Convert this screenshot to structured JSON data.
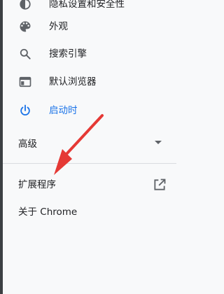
{
  "menu": {
    "items": [
      {
        "label": "隐私设置和安全性",
        "icon": "privacy-shield-icon"
      },
      {
        "label": "外观",
        "icon": "palette-icon"
      },
      {
        "label": "搜索引擎",
        "icon": "search-icon"
      },
      {
        "label": "默认浏览器",
        "icon": "browser-window-icon"
      },
      {
        "label": "启动时",
        "icon": "power-icon",
        "active": true
      }
    ],
    "advanced_label": "高级",
    "extensions_label": "扩展程序",
    "about_label": "关于 Chrome"
  },
  "colors": {
    "accent": "#1a73e8",
    "text": "#202124",
    "icon": "#5f6368",
    "background": "#f8f9fa",
    "annotation_arrow": "#e53935"
  }
}
